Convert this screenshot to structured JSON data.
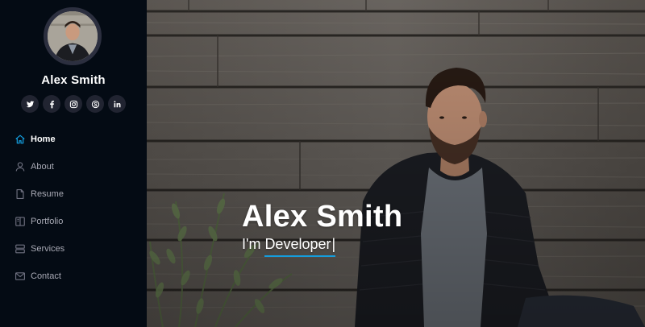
{
  "profile": {
    "name": "Alex Smith",
    "avatar_alt": "profile-photo"
  },
  "socials": [
    {
      "name": "twitter-icon"
    },
    {
      "name": "facebook-icon"
    },
    {
      "name": "instagram-icon"
    },
    {
      "name": "skype-icon"
    },
    {
      "name": "linkedin-icon"
    }
  ],
  "nav": {
    "items": [
      {
        "label": "Home",
        "icon": "home-icon",
        "active": true
      },
      {
        "label": "About",
        "icon": "user-icon",
        "active": false
      },
      {
        "label": "Resume",
        "icon": "file-icon",
        "active": false
      },
      {
        "label": "Portfolio",
        "icon": "book-icon",
        "active": false
      },
      {
        "label": "Services",
        "icon": "server-icon",
        "active": false
      },
      {
        "label": "Contact",
        "icon": "envelope-icon",
        "active": false
      }
    ]
  },
  "hero": {
    "title": "Alex Smith",
    "prefix": "I'm",
    "typed": "Developer",
    "cursor": "|"
  },
  "colors": {
    "accent": "#149ddd",
    "sidebar_bg": "#040b14",
    "social_bg": "#212431",
    "nav_text": "#a8a9b4"
  }
}
